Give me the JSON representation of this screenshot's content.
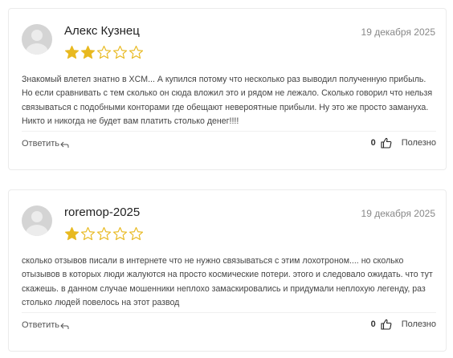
{
  "colors": {
    "star_filled": "#e8b920",
    "star_empty": "#e8b920",
    "border": "#ebebeb"
  },
  "reviews": [
    {
      "author": "Алекс Кузнец",
      "date": "19 декабря 2025",
      "rating": 2,
      "max_rating": 5,
      "text": "Знакомый влетел знатно в XCM... А купился потому что несколько раз выводил полученную прибыль. Но если сравнивать с тем сколько он сюда вложил это и рядом не лежало. Сколько говорил что нельзя связываться с подобными конторами где обещают невероятные прибыли. Ну это же просто замануха. Никто и никогда не будет вам платить столько денег!!!!",
      "reply_label": "Ответить",
      "useful_count": "0",
      "useful_label": "Полезно"
    },
    {
      "author": "roremop-2025",
      "date": "19 декабря 2025",
      "rating": 1,
      "max_rating": 5,
      "text": "сколько отзывов писали в интернете что не нужно связываться с этим лохотроном.... но сколько отызывов в которых люди жалуются на просто космические потери. этого и следовало ожидать. что тут скажешь. в данном случае мошенники неплохо замаскировались и придумали неплохую легенду, раз столько людей повелось на этот развод",
      "reply_label": "Ответить",
      "useful_count": "0",
      "useful_label": "Полезно"
    }
  ]
}
